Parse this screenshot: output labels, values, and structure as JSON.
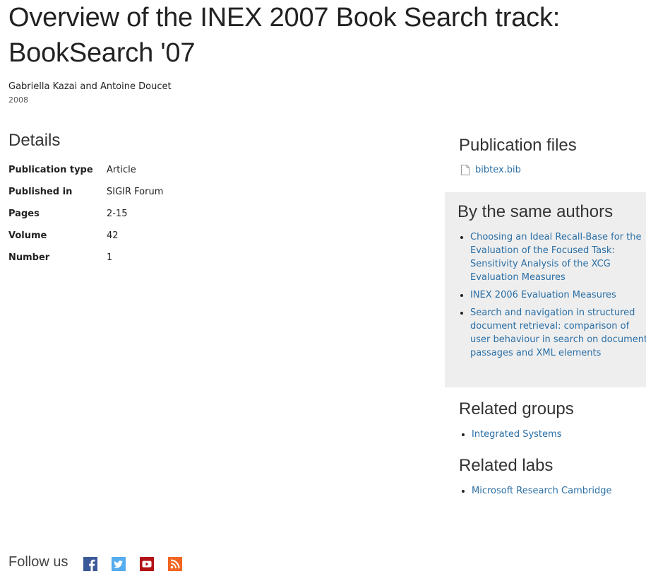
{
  "page": {
    "title": "Overview of the INEX 2007 Book Search track: BookSearch '07",
    "authors": "Gabriella Kazai and Antoine Doucet",
    "year": "2008"
  },
  "details": {
    "heading": "Details",
    "rows": [
      {
        "label": "Publication type",
        "value": "Article"
      },
      {
        "label": "Published in",
        "value": "SIGIR Forum"
      },
      {
        "label": "Pages",
        "value": "2-15"
      },
      {
        "label": "Volume",
        "value": "42"
      },
      {
        "label": "Number",
        "value": "1"
      }
    ]
  },
  "publication_files": {
    "heading": "Publication files",
    "file": "bibtex.bib"
  },
  "same_authors": {
    "heading": "By the same authors",
    "items": [
      "Choosing an Ideal Recall-Base for the Evaluation of the Focused Task: Sensitivity Analysis of the XCG Evaluation Measures",
      "INEX 2006 Evaluation Measures",
      "Search and navigation in structured document retrieval: comparison of user behaviour in search on document passages and XML elements"
    ]
  },
  "related_groups": {
    "heading": "Related groups",
    "items": [
      "Integrated Systems"
    ]
  },
  "related_labs": {
    "heading": "Related labs",
    "items": [
      "Microsoft Research Cambridge"
    ]
  },
  "footer": {
    "follow_label": "Follow us",
    "social_icons": [
      "facebook-icon",
      "twitter-icon",
      "youtube-icon",
      "rss-icon"
    ]
  },
  "colors": {
    "link": "#2a6fa6",
    "sidebar_box": "#eeeeee",
    "facebook": "#3b5998",
    "twitter": "#55acee",
    "youtube": "#b31217",
    "rss": "#f26522"
  }
}
